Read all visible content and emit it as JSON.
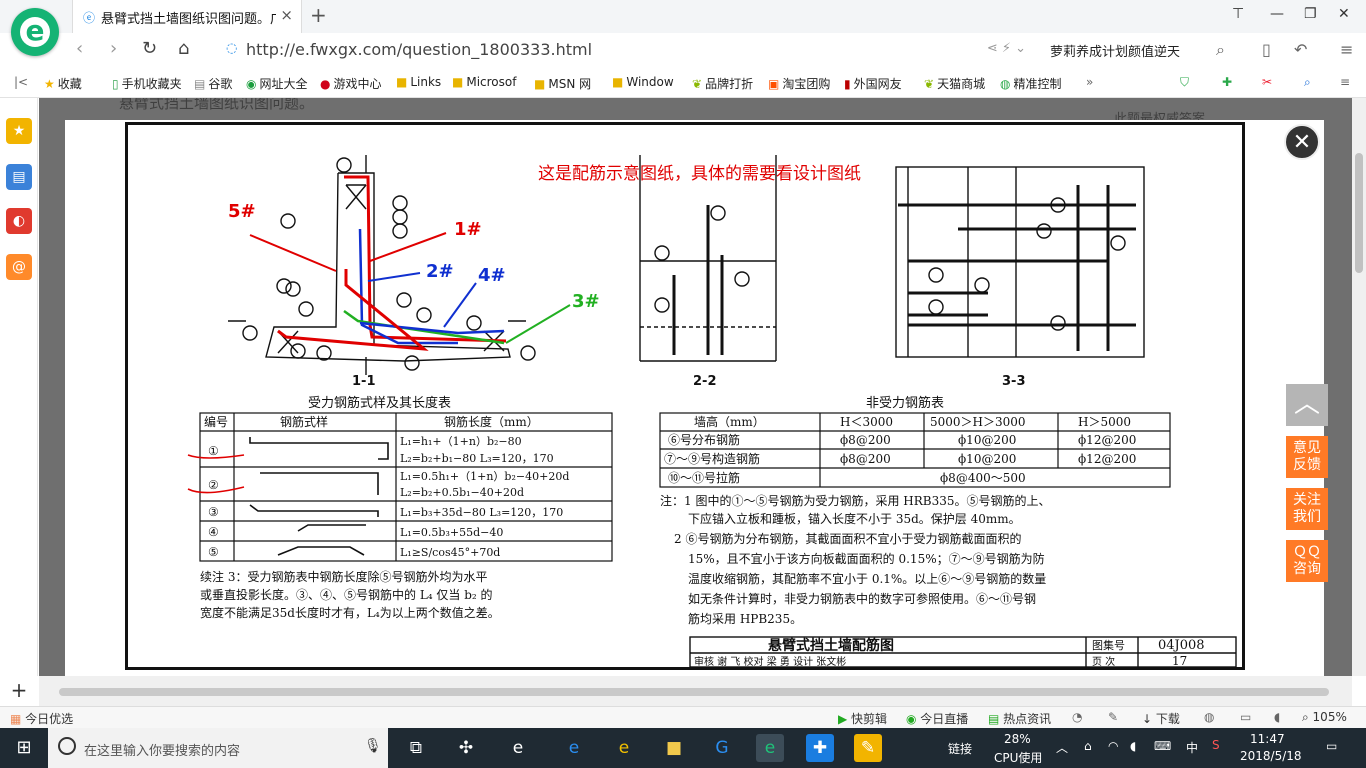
{
  "browser": {
    "logo_letter": "e",
    "tab": {
      "title": "悬臂式挡土墙图纸识图问题。广",
      "close": "×"
    },
    "new_tab": "+",
    "window_buttons": {
      "skin": "⊤",
      "minimize": "—",
      "restore": "❐",
      "close": "✕"
    },
    "nav": {
      "back": "‹",
      "forward": "›",
      "refresh": "↻",
      "home": "⌂"
    },
    "url": "http://e.fwxgx.com/question_1800333.html",
    "promo_text": "萝莉养成计划颜值逆天",
    "bookmarks": [
      {
        "icon": "star-icon",
        "label": "收藏"
      },
      {
        "icon": "phone-icon",
        "label": "手机收藏夹"
      },
      {
        "icon": "page-icon",
        "label": "谷歌"
      },
      {
        "icon": "globe-icon",
        "label": "网址大全"
      },
      {
        "icon": "game-icon",
        "label": "游戏中心"
      },
      {
        "icon": "folder-icon",
        "label": "Links"
      },
      {
        "icon": "folder-icon",
        "label": "Microsof"
      },
      {
        "icon": "folder-icon",
        "label": "MSN 网"
      },
      {
        "icon": "folder-icon",
        "label": "Window"
      },
      {
        "icon": "leaf-icon",
        "label": "品牌打折"
      },
      {
        "icon": "tao-icon",
        "label": "淘宝团购"
      },
      {
        "icon": "flag-icon",
        "label": "外国网友"
      },
      {
        "icon": "leaf-icon",
        "label": "天猫商城"
      },
      {
        "icon": "chat-icon",
        "label": "精准控制"
      }
    ],
    "bookmark_more": "»"
  },
  "page_behind": {
    "title": "悬臂式挡土墙图纸识图问题。",
    "right_text": "此题最权威答案"
  },
  "drawing": {
    "annotation": "这是配筋示意图纸，具体的需要看设计图纸",
    "marks": {
      "m5": "5#",
      "m1": "1#",
      "m2": "2#",
      "m4": "4#",
      "m3": "3#"
    },
    "view_labels": {
      "v11": "1-1",
      "v22": "2-2",
      "v33": "3-3"
    },
    "left_table": {
      "title": "受力钢筋式样及其长度表",
      "headers": [
        "编号",
        "钢筋式样",
        "钢筋长度（mm）"
      ],
      "rows": [
        {
          "no": "①",
          "len1": "L₁=h₁+（1+n）b₂−80",
          "len2": "L₂=b₂+b₁−80   L₃=120，170"
        },
        {
          "no": "②",
          "len1": "L₁=0.5h₁+（1+n）b₂−40+20d",
          "len2": "L₂=b₂+0.5b₁−40+20d"
        },
        {
          "no": "③",
          "len1": "L₁=b₃+35d−80   L₃=120，170",
          "len2": ""
        },
        {
          "no": "④",
          "len1": "L₁=0.5b₃+55d−40",
          "len2": ""
        },
        {
          "no": "⑤",
          "len1": "L₁≥S/cos45°+70d",
          "len2": ""
        }
      ],
      "note_lines": [
        "续注 3：受力钢筋表中钢筋长度除⑤号钢筋外均为水平",
        "或垂直投影长度。③、④、⑤号钢筋中的 L₄ 仅当 b₂ 的",
        "宽度不能满足35d长度时才有，L₄为以上两个数值之差。"
      ]
    },
    "right_table": {
      "title": "非受力钢筋表",
      "headers": [
        "墙高（mm）",
        "H＜3000",
        "5000＞H＞3000",
        "H＞5000"
      ],
      "rows": [
        [
          "⑥号分布钢筋",
          "ϕ8@200",
          "ϕ10@200",
          "ϕ12@200"
        ],
        [
          "⑦～⑨号构造钢筋",
          "ϕ8@200",
          "ϕ10@200",
          "ϕ12@200"
        ],
        [
          "⑩～⑪号拉筋",
          "ϕ8@400～500"
        ]
      ],
      "note_lines": [
        "注：1  图中的①～⑤号钢筋为受力钢筋，采用 HRB335。⑤号钢筋的上、",
        "下应锚入立板和踵板，锚入长度不小于 35d。保护层 40mm。",
        "2  ⑥号钢筋为分布钢筋，其截面面积不宜小于受力钢筋截面面积的",
        "15%，且不宜小于该方向板截面面积的 0.15%；⑦～⑨号钢筋为防",
        "温度收缩钢筋，其配筋率不宜小于 0.1%。以上⑥～⑨号钢筋的数量",
        "如无条件计算时，非受力钢筋表中的数字可参照使用。⑥～⑪号钢",
        "筋均采用 HPB235。"
      ]
    },
    "title_block": {
      "title": "悬臂式挡土墙配筋图",
      "atlas_label": "图集号",
      "atlas_no": "04J008",
      "review_row": "审核 谢  飞     校对 梁  勇     设计 张文彬",
      "page_label": "页  次",
      "page_no": "17"
    }
  },
  "modal_close": "✕",
  "float_buttons": {
    "back_top": "︿",
    "feedback": "意见\n反馈",
    "follow": "关注\n我们",
    "qq": "ＱＱ\n咨询"
  },
  "statusbar": {
    "left": "今日优选",
    "items": [
      "快剪辑",
      "今日直播",
      "热点资讯",
      "下载"
    ],
    "zoom": "105%"
  },
  "taskbar": {
    "search_placeholder": "在这里输入你要搜索的内容",
    "links_label": "链接",
    "cpu_percent": "28%",
    "cpu_label": "CPU使用",
    "ime": "中",
    "time": "11:47",
    "date": "2018/5/18"
  }
}
